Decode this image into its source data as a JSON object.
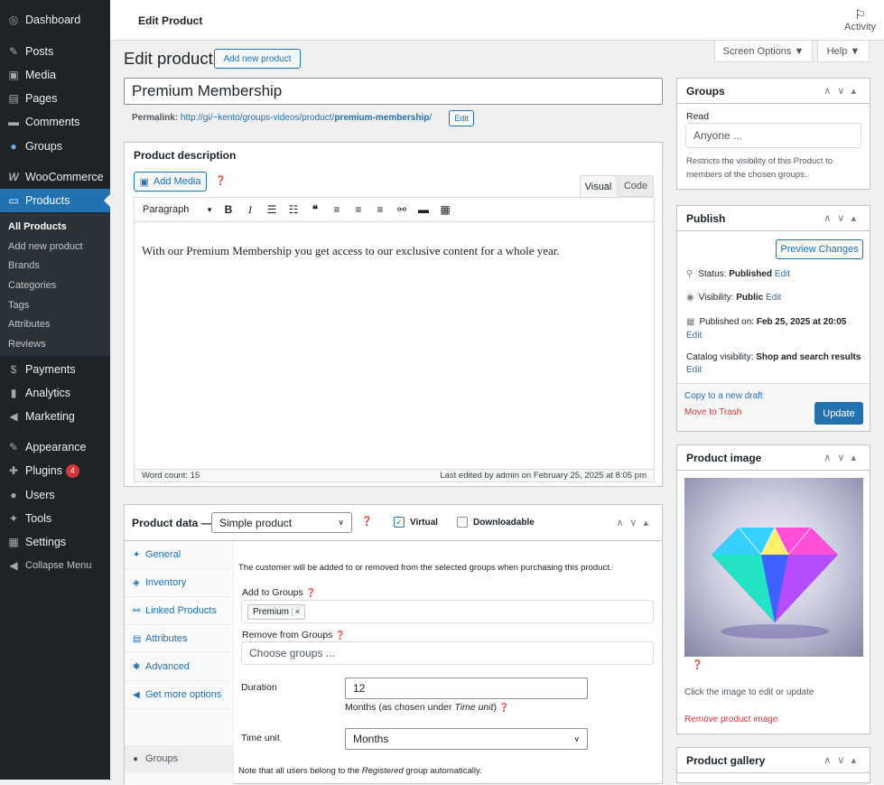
{
  "sidebar": {
    "items": [
      {
        "label": "Dashboard",
        "icon": "dashboard-icon",
        "glyph": "◎"
      },
      {
        "label": "Posts",
        "icon": "pin-icon",
        "glyph": "✎"
      },
      {
        "label": "Media",
        "icon": "media-icon",
        "glyph": "▣"
      },
      {
        "label": "Pages",
        "icon": "pages-icon",
        "glyph": "▤"
      },
      {
        "label": "Comments",
        "icon": "comment-icon",
        "glyph": "▬"
      },
      {
        "label": "Groups",
        "icon": "groups-icon",
        "glyph": "●"
      },
      {
        "label": "WooCommerce",
        "icon": "woo-icon",
        "glyph": "W"
      },
      {
        "label": "Products",
        "icon": "products-icon",
        "glyph": "▭"
      }
    ],
    "submenu": [
      "All Products",
      "Add new product",
      "Brands",
      "Categories",
      "Tags",
      "Attributes",
      "Reviews"
    ],
    "items2": [
      {
        "label": "Payments",
        "icon": "payments-icon",
        "glyph": "$"
      },
      {
        "label": "Analytics",
        "icon": "analytics-icon",
        "glyph": "▮"
      },
      {
        "label": "Marketing",
        "icon": "megaphone-icon",
        "glyph": "◀"
      },
      {
        "label": "Appearance",
        "icon": "brush-icon",
        "glyph": "✎"
      },
      {
        "label": "Plugins",
        "icon": "plugin-icon",
        "glyph": "✚",
        "badge": "4"
      },
      {
        "label": "Users",
        "icon": "users-icon",
        "glyph": "●"
      },
      {
        "label": "Tools",
        "icon": "wrench-icon",
        "glyph": "✦"
      },
      {
        "label": "Settings",
        "icon": "settings-icon",
        "glyph": "▦"
      },
      {
        "label": "Collapse Menu",
        "icon": "collapse-icon",
        "glyph": "◀"
      }
    ]
  },
  "topbar": {
    "title": "Edit Product",
    "activity": "Activity"
  },
  "screen_options": "Screen Options ▼",
  "help": "Help ▼",
  "page": {
    "heading": "Edit product",
    "add_new": "Add new product"
  },
  "product": {
    "title": "Premium Membership",
    "permalink_label": "Permalink:",
    "permalink_base": "http://gi/~kento/groups-videos/product/",
    "permalink_slug": "premium-membership",
    "permalink_end": "/",
    "edit": "Edit"
  },
  "description": {
    "heading": "Product description",
    "add_media": "Add Media",
    "tab_visual": "Visual",
    "tab_code": "Code",
    "format": "Paragraph",
    "content": "With our Premium Membership you get access to our exclusive content for a whole year.",
    "word_count": "Word count: 15",
    "last_edited": "Last edited by admin on February 25, 2025 at 8:05 pm"
  },
  "product_data": {
    "heading": "Product data —",
    "type": "Simple product",
    "virtual": "Virtual",
    "downloadable": "Downloadable",
    "tabs": [
      "General",
      "Inventory",
      "Linked Products",
      "Attributes",
      "Advanced",
      "Get more options",
      "Groups"
    ],
    "note": "The customer will be added to or removed from the selected groups when purchasing this product.",
    "add_groups": "Add to Groups",
    "add_tag": "Premium",
    "remove_groups": "Remove from Groups",
    "remove_placeholder": "Choose groups ...",
    "duration_label": "Duration",
    "duration": "12",
    "duration_hint_a": "Months (as chosen under ",
    "duration_hint_b": "Time unit",
    "duration_hint_c": ")",
    "time_unit_label": "Time unit",
    "time_unit": "Months",
    "footer_a": "Note that all users belong to the ",
    "footer_b": "Registered",
    "footer_c": " group automatically."
  },
  "groups_box": {
    "title": "Groups",
    "read": "Read",
    "placeholder": "Anyone ...",
    "help": "Restricts the visibility of this Product to members of the chosen groups."
  },
  "publish": {
    "title": "Publish",
    "preview": "Preview Changes",
    "status_label": "Status:",
    "status": "Published",
    "visibility_label": "Visibility:",
    "visibility": "Public",
    "published_label": "Published on:",
    "published": "Feb 25, 2025 at 20:05",
    "catalog_label": "Catalog visibility:",
    "catalog": "Shop and search results",
    "edit": "Edit",
    "copy": "Copy to a new draft",
    "trash": "Move to Trash",
    "update": "Update"
  },
  "image_box": {
    "title": "Product image",
    "hint": "Click the image to edit or update",
    "remove": "Remove product image"
  },
  "gallery": {
    "title": "Product gallery"
  },
  "colors": {
    "accent": "#2271b1",
    "sidebar": "#1d2327",
    "trash": "#d63638"
  }
}
